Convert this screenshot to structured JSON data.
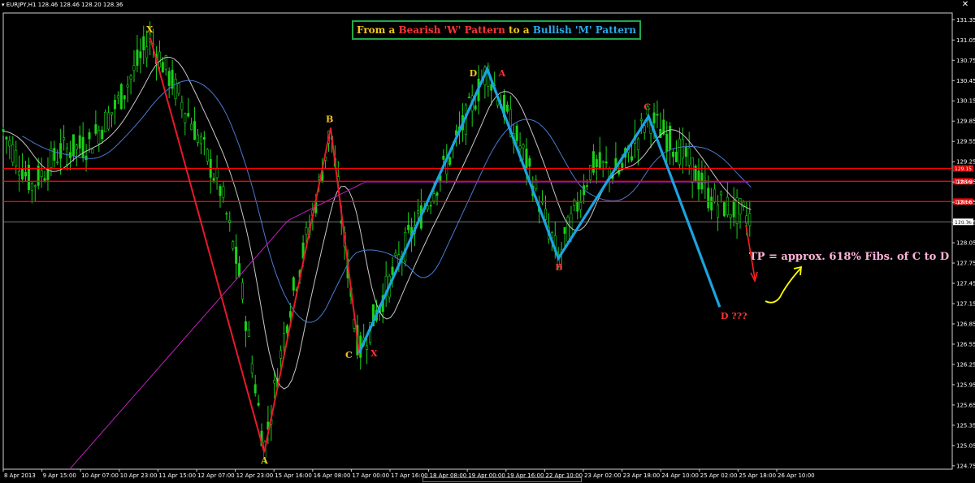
{
  "window": {
    "symbol_title": "EURJPY,H1  128.46 128.46 128.20 128.36",
    "close_glyph": "✕"
  },
  "headline": {
    "part1": "From a ",
    "part2": "Bearish 'W' Pattern",
    "part3": " to a ",
    "part4": "Bullish 'M' Pattern",
    "colors": {
      "part1": "#f5c518",
      "part2": "#ff3333",
      "part3": "#f5c518",
      "part4": "#29a8e8"
    }
  },
  "annotation": {
    "tp_text": "TP = approx. 618% Fibs. of C to D",
    "d_text": "D ???"
  },
  "colors": {
    "candle": "#19d219",
    "red_line": "#ff0000",
    "w_pattern": "#e8192c",
    "m_pattern": "#1ba3e0",
    "ma_fast": "#c8c8c8",
    "ma_slow": "#4a7ad0",
    "ma_long": "#c020c0",
    "yellow_arrow": "#ffff00",
    "red_arrow": "#ff2020",
    "tag_fill": "#e00000",
    "current_tag_fill": "#ffffff"
  },
  "chart_data": {
    "type": "candlestick",
    "symbol": "EURJPY",
    "timeframe": "H1",
    "ohlc": {
      "open": 128.46,
      "high": 128.46,
      "low": 128.2,
      "close": 128.36
    },
    "ylim": [
      124.7,
      131.45
    ],
    "y_ticks": [
      "131.35",
      "131.05",
      "130.75",
      "130.45",
      "130.15",
      "129.85",
      "129.55",
      "129.25",
      "128.95",
      "128.65",
      "128.35",
      "128.05",
      "127.75",
      "127.45",
      "127.15",
      "126.85",
      "126.55",
      "126.25",
      "125.95",
      "125.65",
      "125.35",
      "125.05",
      "124.75"
    ],
    "x_ticks": [
      "8 Apr 2013",
      "9 Apr 15:00",
      "10 Apr 07:00",
      "10 Apr 23:00",
      "11 Apr 15:00",
      "12 Apr 07:00",
      "12 Apr 23:00",
      "15 Apr 16:00",
      "16 Apr 08:00",
      "17 Apr 00:00",
      "17 Apr 16:00",
      "18 Apr 08:00",
      "19 Apr 00:00",
      "19 Apr 16:00",
      "22 Apr 10:00",
      "23 Apr 02:00",
      "23 Apr 18:00",
      "24 Apr 10:00",
      "25 Apr 02:00",
      "25 Apr 18:00",
      "26 Apr 10:00"
    ],
    "horizontal_levels": [
      {
        "price": 129.15,
        "tag": "129.15"
      },
      {
        "price": 128.96,
        "tag": "128.96"
      },
      {
        "price": 128.66,
        "tag": "128.66"
      }
    ],
    "current_price": {
      "price": 128.36,
      "tag": "128.36"
    },
    "w_pattern_bearish": [
      {
        "label": "X",
        "time_index": 0.155,
        "price": 131.08
      },
      {
        "label": "A",
        "time_index": 0.275,
        "price": 124.95
      },
      {
        "label": "B",
        "time_index": 0.345,
        "price": 129.75
      },
      {
        "label": "C",
        "time_index": 0.375,
        "price": 126.42
      },
      {
        "label": "D",
        "time_index": 0.51,
        "price": 130.62
      }
    ],
    "m_pattern_bullish": [
      {
        "label": "X",
        "time_index": 0.375,
        "price": 126.42
      },
      {
        "label": "A",
        "time_index": 0.51,
        "price": 130.62
      },
      {
        "label": "B",
        "time_index": 0.585,
        "price": 127.82
      },
      {
        "label": "C",
        "time_index": 0.68,
        "price": 129.92
      },
      {
        "label": "D",
        "time_index": 0.755,
        "price": 127.1
      }
    ],
    "grid": false
  }
}
